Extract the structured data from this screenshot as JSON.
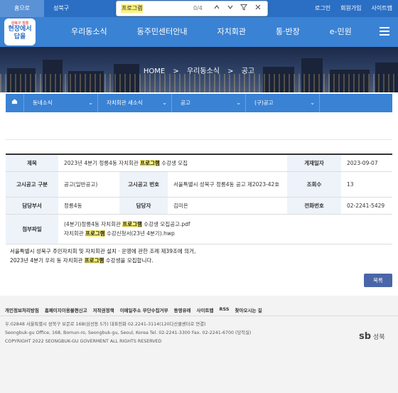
{
  "topbar": {
    "home_tab": "홈으로",
    "gu_tab": "성북구청",
    "right_links": [
      "로그인",
      "회원가입",
      "사이트맵"
    ]
  },
  "findbar": {
    "query": "프로그램",
    "count": "0/4",
    "icons": [
      "chevron-up-icon",
      "chevron-down-icon",
      "filter-icon",
      "close-icon"
    ]
  },
  "logo": {
    "line1": "현장에서",
    "line2": "답을",
    "small": "성북구 정릉"
  },
  "gnb": {
    "menu": [
      "우리동소식",
      "동주민센터안내",
      "자치회관",
      "통·반장",
      "e-민원"
    ]
  },
  "hero": {
    "crumbs": [
      "HOME",
      ">",
      "우리동소식",
      ">",
      "공고"
    ]
  },
  "subnav": {
    "dropdowns": [
      "동네소식",
      "자치회관 새소식",
      "공고",
      "(구)공고"
    ]
  },
  "view": {
    "title_label": "제목",
    "title_pre": "2023년 4분기 정릉4동 자치회관 ",
    "title_hl": "프로그램",
    "title_post": " 수강생 모집",
    "date_label": "게재일자",
    "date_value": "2023-09-07",
    "type_label": "고시공고 구분",
    "type_value": "공고(일반공고)",
    "number_label": "고시공고 번호",
    "number_value": "서울특별시 성북구 정릉4동 공고 제2023-42호",
    "views_label": "조회수",
    "views_value": "13",
    "dept_label": "담당부서",
    "dept_value": "정릉4동",
    "person_label": "담당자",
    "person_value": "김미은",
    "phone_label": "전화번호",
    "phone_value": "02-2241-5429",
    "attach_label": "첨부파일",
    "attach1_pre": "(4분기)정릉4동 자치회관 ",
    "attach1_hl": "프로그램",
    "attach1_post": " 수강생 모집공고.pdf",
    "attach2_pre": "자치회관 ",
    "attach2_hl": "프로그램",
    "attach2_post": " 수강신청서(23년 4분기).hwp"
  },
  "content": {
    "line1": "서울특별시 성북구 주민자치회 및 자치회관 설치 · 운영에 관한 조례 제39조에 의거,",
    "line2_pre": "2023년 4분기 우리 동 자치회관 ",
    "line2_hl": "프로그램",
    "line2_post": " 수강생을 모집합니다."
  },
  "buttons": {
    "list": "목록"
  },
  "footer": {
    "links": [
      "개인정보처리방침",
      "홈페이지이용불편신고",
      "저작권정책",
      "이메일주소 무단수집거부",
      "동영유래",
      "사이트맵",
      "RSS",
      "찾아오시는 길"
    ],
    "addr1": "우.02848 서울특별시 성북구 보문로 168(삼선동 5가) 대표전화 02.2241-3114(120다산콜센터로 연결)",
    "addr2": "Seongbuk-gu Office, 168, Bomun-ro, Seongbuk-gu, Seoul, Korea Tel. 02-2241-3300 Fax. 02-2241-6700 (당직실)",
    "addr3": "COPYRIGHT 2022 SEONGBUK-GU GOVERMENT ALL RIGHTS RESERVED",
    "logo_mark": "sb",
    "logo_text": "성북"
  }
}
